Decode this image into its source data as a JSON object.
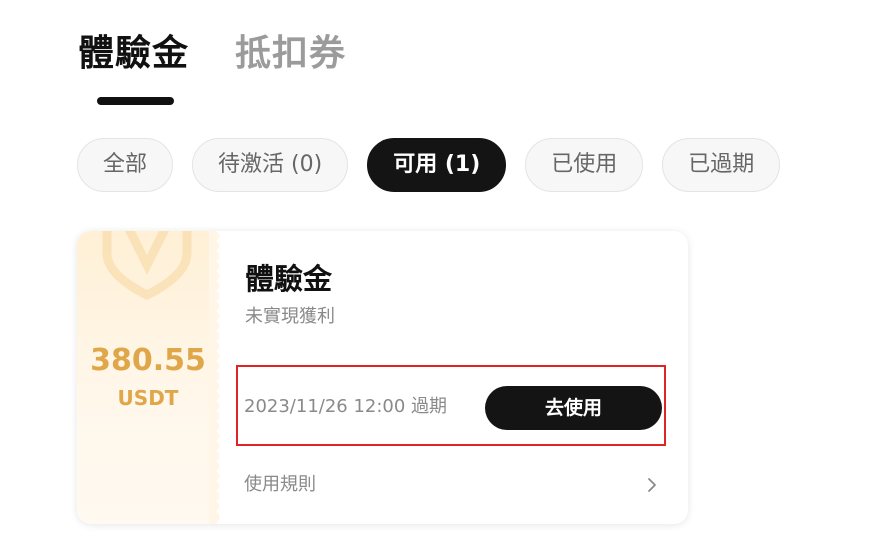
{
  "main_tabs": [
    {
      "label": "體驗金",
      "active": true
    },
    {
      "label": "抵扣券",
      "active": false
    }
  ],
  "filters": [
    {
      "label": "全部",
      "active": false
    },
    {
      "label": "待激活 (0)",
      "active": false
    },
    {
      "label": "可用 (1)",
      "active": true
    },
    {
      "label": "已使用",
      "active": false
    },
    {
      "label": "已過期",
      "active": false
    }
  ],
  "voucher": {
    "amount": "380.55",
    "unit": "USDT",
    "title": "體驗金",
    "subtitle": "未實現獲利",
    "expiry": "2023/11/26 12:00 過期",
    "use_label": "去使用",
    "rules_label": "使用規則",
    "watermark_icon": "shield-v-icon",
    "chevron_icon": "chevron-right-icon"
  },
  "colors": {
    "accent_gold": "#e0a64a",
    "primary_dark": "#141414",
    "highlight_red": "#e02424",
    "muted_text": "#8a8a8a"
  }
}
